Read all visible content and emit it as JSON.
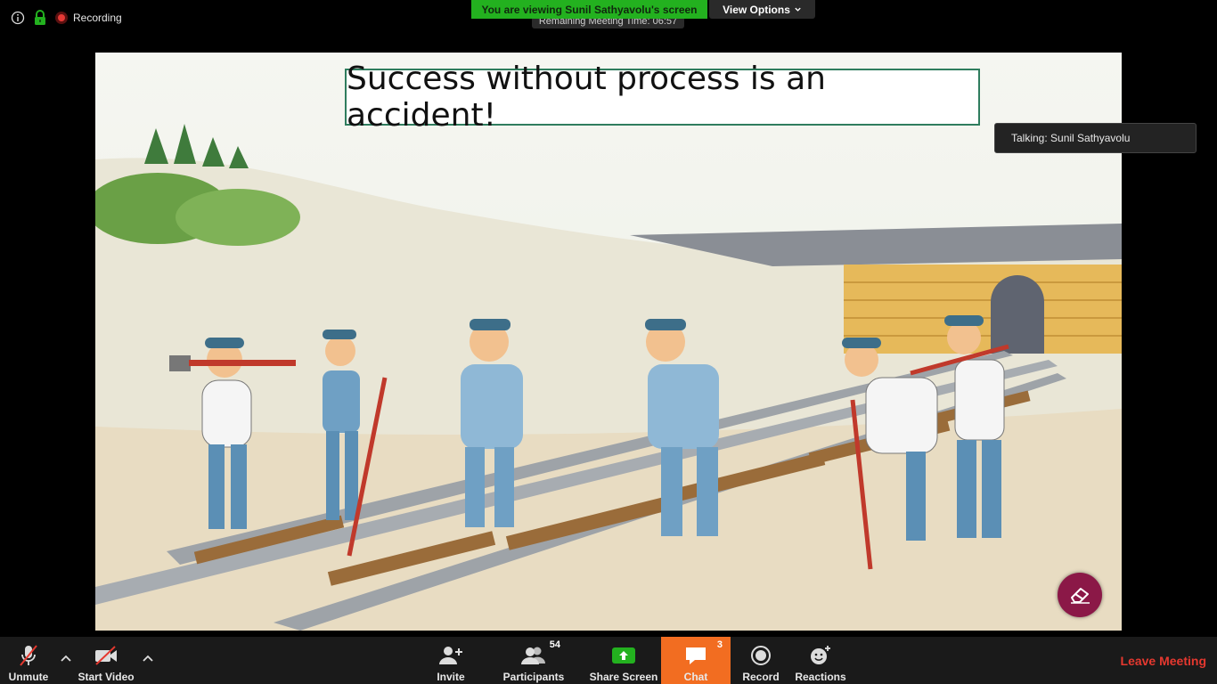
{
  "top_status": {
    "recording_label": "Recording"
  },
  "banner": {
    "viewing_text": "You are viewing Sunil Sathyavolu's screen",
    "view_options_label": "View Options",
    "remaining_text": "Remaining Meeting Time: 06:57"
  },
  "slide": {
    "title": "Success without process is an accident!"
  },
  "talking": {
    "text": "Talking: Sunil Sathyavolu"
  },
  "toolbar": {
    "unmute_label": "Unmute",
    "start_video_label": "Start Video",
    "invite_label": "Invite",
    "participants_label": "Participants",
    "participants_count": "54",
    "share_screen_label": "Share Screen",
    "chat_label": "Chat",
    "chat_count": "3",
    "record_label": "Record",
    "reactions_label": "Reactions",
    "leave_label": "Leave Meeting"
  },
  "colors": {
    "accent_green": "#23b11f",
    "chat_orange": "#f26d21",
    "leave_red": "#e5382f"
  }
}
